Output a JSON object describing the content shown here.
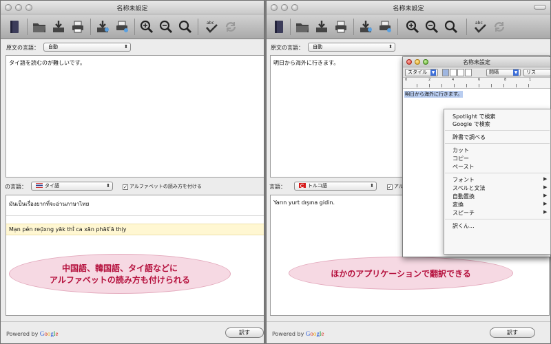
{
  "window_title": "名称未設定",
  "toolbar_icons": [
    "document-icon",
    "open-folder-icon",
    "import-icon",
    "print-icon",
    "import-speech-icon",
    "print-speech-icon",
    "zoom-in-icon",
    "zoom-out-icon",
    "zoom-reset-icon",
    "spellcheck-icon",
    "refresh-icon"
  ],
  "left": {
    "source_label": "原文の言語：",
    "source_lang": "自動",
    "source_text": "タイ語を読むのが難しいです。",
    "target_label": "の言語：",
    "target_lang": "タイ語",
    "alphabet_checkbox": "アルファベットの読み方を付ける",
    "output_text": "มันเป็นเรื่องยากที่จะอ่านภาษาไทย",
    "romanization": "Mạn pĕn reụ̄xng yāk thī̀ ca xān phās̄ʹā thịy",
    "callout_line1": "中国語、韓国語、タイ語などに",
    "callout_line2": "アルファベットの読み方も付けられる",
    "powered_by": "Powered by",
    "translate_button": "訳す"
  },
  "right": {
    "source_label": "原文の言語：",
    "source_lang": "自動",
    "source_text": "明日から海外に行きます。",
    "target_label": "言語：",
    "target_lang": "トルコ語",
    "alphabet_checkbox_partial": "アル",
    "output_text": "Yarın yurt dışına gidin.",
    "callout": "ほかのアプリケーションで翻訳できる",
    "powered_by": "Powered by",
    "translate_button": "訳す"
  },
  "google_logo": "Google",
  "textedit": {
    "title": "名称未設定",
    "style_popup": "スタイル",
    "spacing_popup": "間隔",
    "list_popup": "リス",
    "ruler_numbers": [
      "0",
      "2",
      "4",
      "6",
      "8",
      "1"
    ],
    "text": "明日から海外に行きます。"
  },
  "context_menu": {
    "items": [
      "Spotlight で検索",
      "Google で検索",
      "辞書で調べる",
      "カット",
      "コピー",
      "ペースト",
      "フォント",
      "スペルと文法",
      "自動置換",
      "変換",
      "スピーチ",
      "訳くん..."
    ],
    "submenu_arrow": "▶"
  },
  "colors": {
    "callout_fill": "#f6d9e3",
    "callout_text": "#b5103d",
    "romanization_bg": "#fff7d2"
  }
}
